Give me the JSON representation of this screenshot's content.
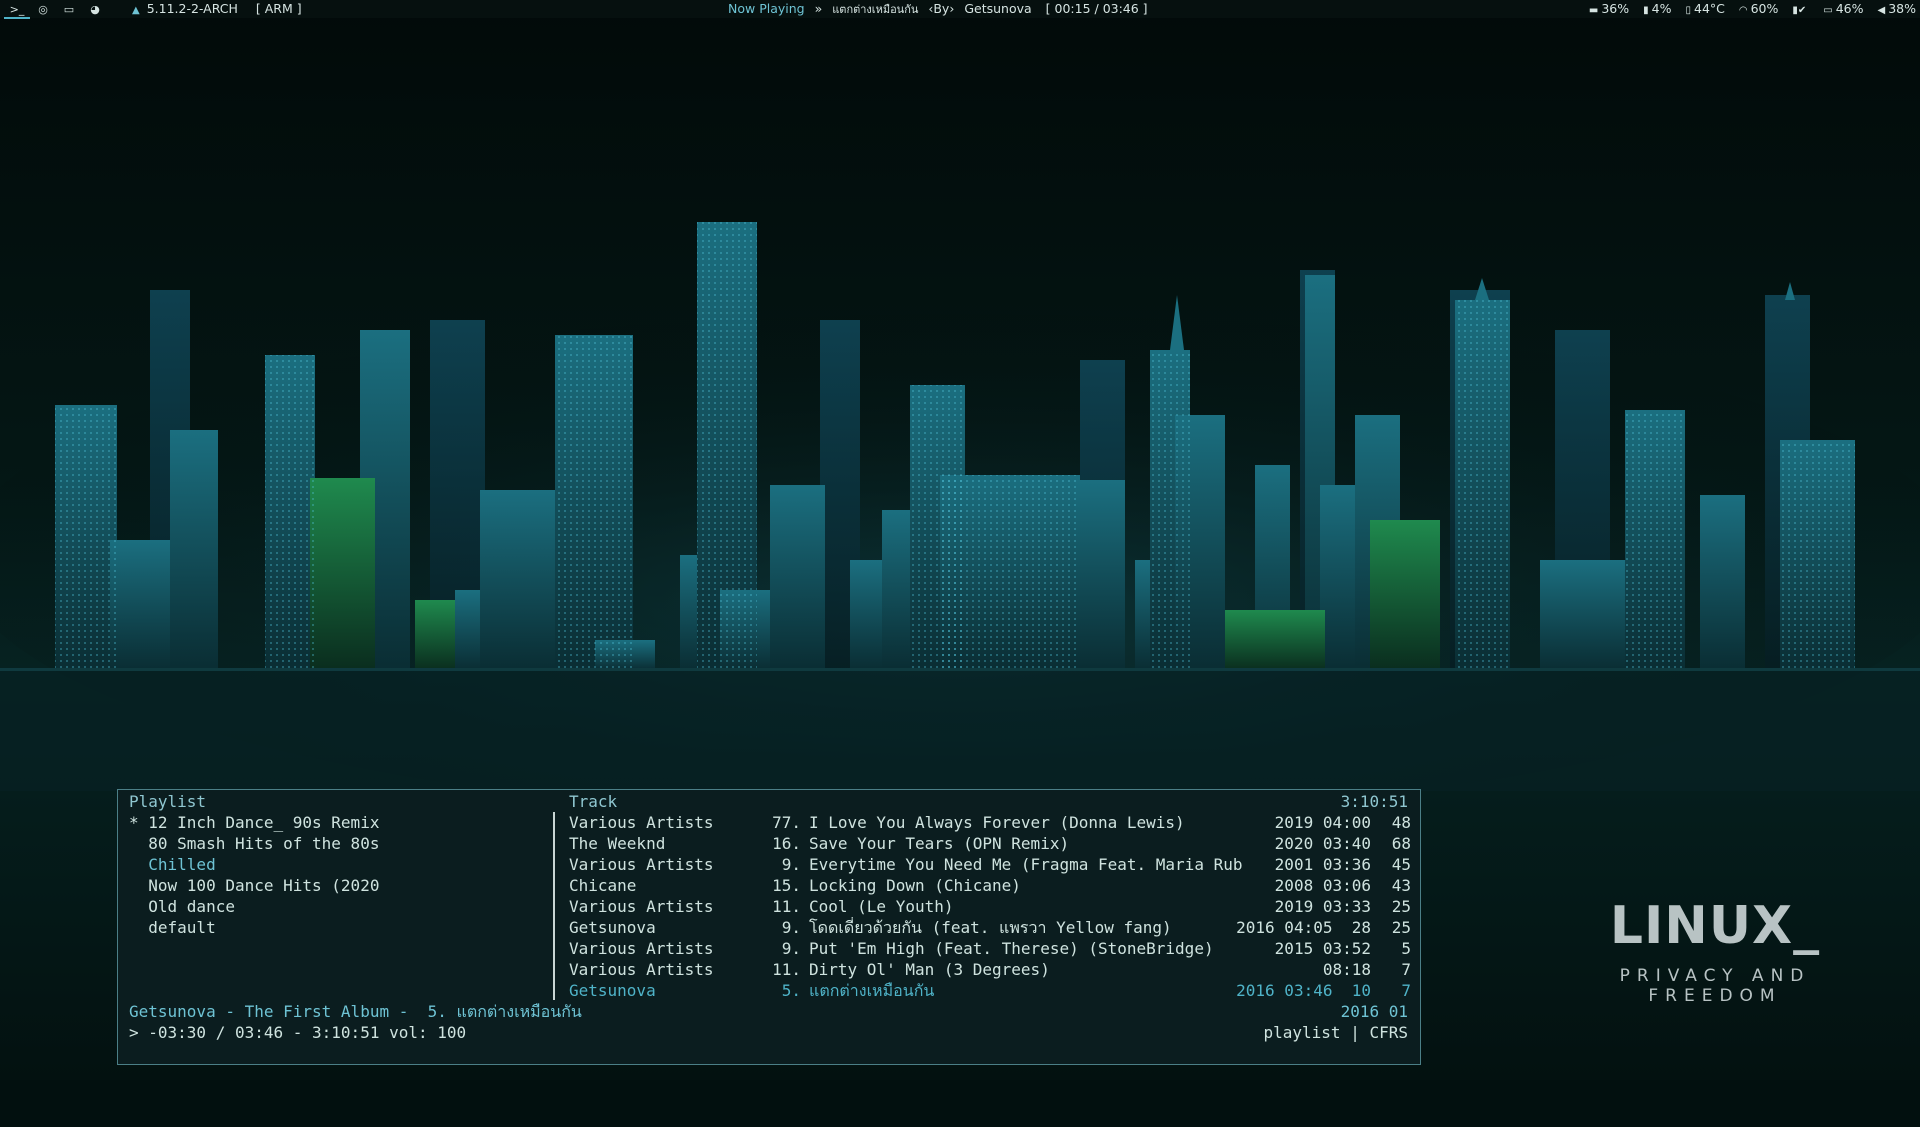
{
  "topbar": {
    "workspaces": [
      "terminal-icon",
      "globe-icon",
      "folder-icon",
      "palette-icon"
    ],
    "kernel": "5.11.2-2-ARCH",
    "arch": "[ ARM ]",
    "now_playing_label": "Now Playing",
    "song": "แตกต่างเหมือนกัน",
    "by_label": "By",
    "artist": "Getsunova",
    "time": "[ 00:15  /  03:46 ]",
    "stats": {
      "mem": "36%",
      "disk": "4%",
      "temp": "44°C",
      "wifi": "60%",
      "battery": "46%",
      "volume": "38%"
    }
  },
  "logo": {
    "title": "LINUX_",
    "subtitle": "PRIVACY AND FREEDOM"
  },
  "cmus": {
    "playlist_header": "Playlist",
    "track_header": "Track",
    "total_time": "3:10:51",
    "playlists": [
      "* 12 Inch Dance_ 90s Remix",
      "  80 Smash Hits of the 80s",
      "  Chilled",
      "  Now 100 Dance Hits (2020",
      "  Old dance",
      "  default"
    ],
    "tracks": [
      {
        "artist": "Various Artists",
        "num": "77.",
        "title": "I Love You Always Forever (Donna Lewis)",
        "date": "2019 04:00",
        "rate": "48"
      },
      {
        "artist": "The Weeknd",
        "num": "16.",
        "title": "Save Your Tears (OPN Remix)",
        "date": "2020 03:40",
        "rate": "68"
      },
      {
        "artist": "Various Artists",
        "num": "9.",
        "title": "Everytime You Need Me (Fragma Feat. Maria Rub",
        "date": "2001 03:36",
        "rate": "45"
      },
      {
        "artist": "Chicane",
        "num": "15.",
        "title": "Locking Down (Chicane)",
        "date": "2008 03:06",
        "rate": "43"
      },
      {
        "artist": "Various Artists",
        "num": "11.",
        "title": "Cool (Le Youth)",
        "date": "2019 03:33",
        "rate": "25"
      },
      {
        "artist": "Getsunova",
        "num": "9.",
        "title": "โดดเดี่ยวด้วยกัน (feat. แพรวา Yellow fang)",
        "date": "2016 04:05  28",
        "rate": "25"
      },
      {
        "artist": "Various Artists",
        "num": "9.",
        "title": "Put 'Em High (Feat. Therese) (StoneBridge)",
        "date": "2015 03:52",
        "rate": "5"
      },
      {
        "artist": "Various Artists",
        "num": "11.",
        "title": "Dirty Ol' Man (3 Degrees)",
        "date": "08:18",
        "rate": "7"
      },
      {
        "artist": "Getsunova",
        "num": "5.",
        "title": "แตกต่างเหมือนกัน",
        "date": "2016 03:46  10",
        "rate": "7"
      }
    ],
    "status_line": "Getsunova - The First Album -  5. แตกต่างเหมือนกัน",
    "status_right": "2016 01",
    "progress_line": "> -03:30 / 03:46 - 3:10:51 vol: 100",
    "mode_line": "playlist | CFRS"
  }
}
